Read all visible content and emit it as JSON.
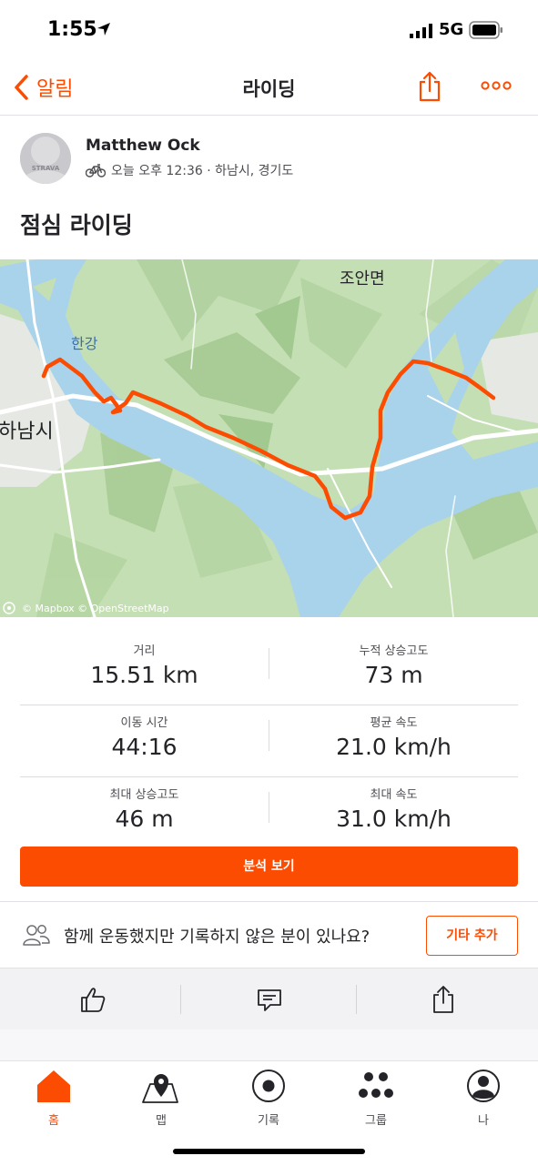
{
  "status_bar": {
    "time": "1:55",
    "network": "5G"
  },
  "nav": {
    "back_label": "알림",
    "title": "라이딩"
  },
  "activity": {
    "athlete_name": "Matthew Ock",
    "avatar_text": "STRAVA",
    "meta": "오늘 오후 12:36 · 하남시, 경기도",
    "title": "점심 라이딩"
  },
  "map": {
    "labels": {
      "joan": "조안면",
      "hangang": "한강",
      "hanam": "하남시"
    },
    "attribution": "© Mapbox © OpenStreetMap",
    "route_color": "#fc4c02"
  },
  "stats": [
    {
      "left": {
        "label": "거리",
        "value": "15.51 km"
      },
      "right": {
        "label": "누적 상승고도",
        "value": "73 m"
      }
    },
    {
      "left": {
        "label": "이동 시간",
        "value": "44:16"
      },
      "right": {
        "label": "평균 속도",
        "value": "21.0 km/h"
      }
    },
    {
      "left": {
        "label": "최대 상승고도",
        "value": "46 m"
      },
      "right": {
        "label": "최대 속도",
        "value": "31.0 km/h"
      }
    }
  ],
  "analysis_button": "분석 보기",
  "tag_prompt": {
    "text": "함께 운동했지만 기록하지 않은 분이 있나요?",
    "button": "기타 추가"
  },
  "tabs": [
    {
      "label": "홈",
      "icon": "home-icon"
    },
    {
      "label": "맵",
      "icon": "map-icon"
    },
    {
      "label": "기록",
      "icon": "record-icon"
    },
    {
      "label": "그룹",
      "icon": "groups-icon"
    },
    {
      "label": "나",
      "icon": "profile-icon"
    }
  ],
  "colors": {
    "accent": "#fc4c02",
    "text": "#242428",
    "water": "#a9d3eb",
    "land": "#c5dfb5"
  }
}
